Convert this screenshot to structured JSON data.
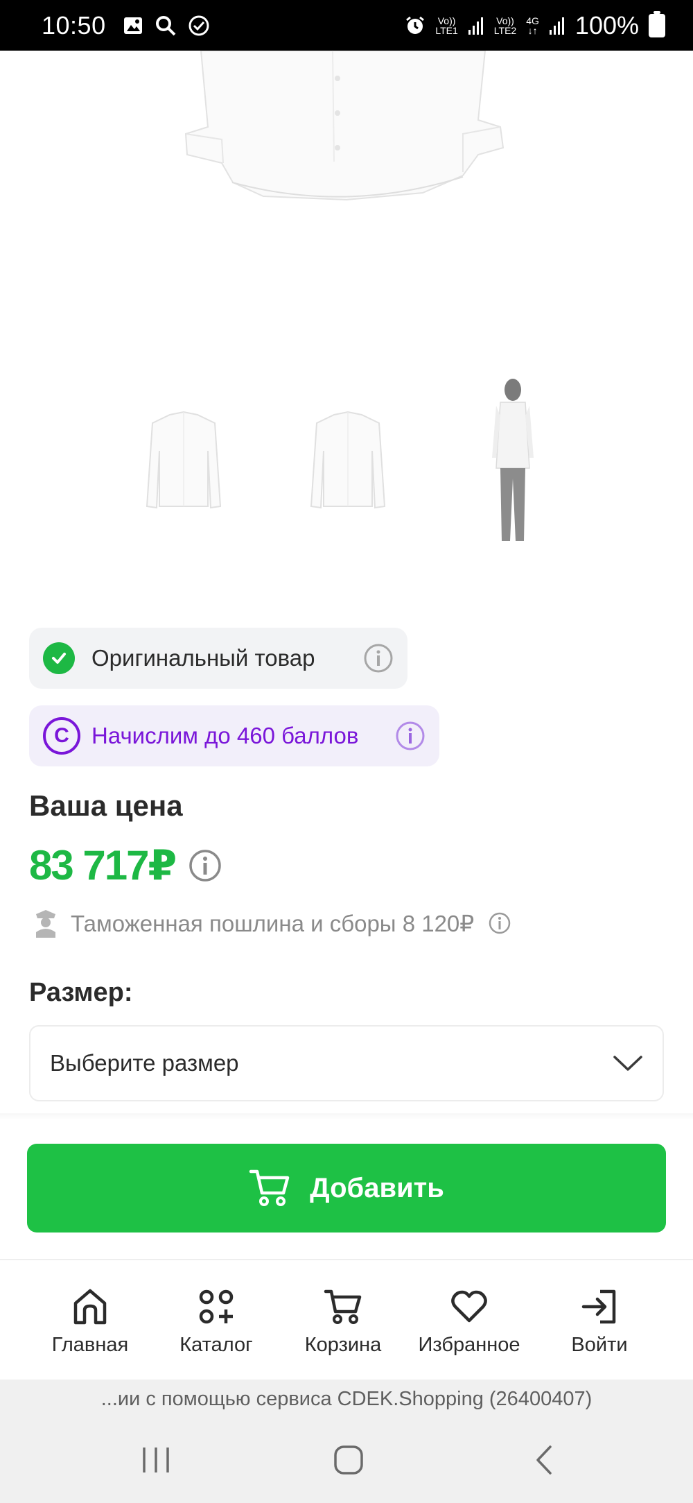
{
  "status_bar": {
    "time": "10:50",
    "battery": "100%",
    "sim1": "LTE1",
    "sim2": "LTE2",
    "network": "4G"
  },
  "badges": {
    "original": "Оригинальный товар",
    "points": "Начислим до 460 баллов",
    "points_icon_letter": "C"
  },
  "price": {
    "title": "Ваша цена",
    "value": "83 717₽",
    "customs": "Таможенная пошлина и сборы 8 120₽"
  },
  "size": {
    "title": "Размер:",
    "placeholder": "Выберите размер"
  },
  "cart_button": {
    "label": "Добавить"
  },
  "bottom_nav": [
    {
      "label": "Главная",
      "icon": "home-icon"
    },
    {
      "label": "Каталог",
      "icon": "catalog-icon"
    },
    {
      "label": "Корзина",
      "icon": "cart-icon"
    },
    {
      "label": "Избранное",
      "icon": "heart-icon"
    },
    {
      "label": "Войти",
      "icon": "login-icon"
    }
  ],
  "browser": {
    "url_text": "...ии с помощью сервиса CDEK.Shopping (26400407)"
  },
  "colors": {
    "accent_green": "#1ec145",
    "price_green": "#1db844",
    "points_purple": "#7a16d9"
  }
}
